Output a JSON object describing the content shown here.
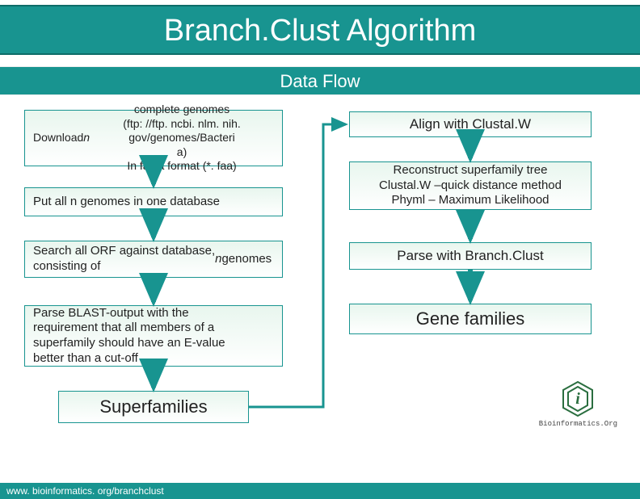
{
  "title": "Branch.Clust Algorithm",
  "subtitle": "Data Flow",
  "left": {
    "box1": "Download n complete genomes\n(ftp: //ftp. ncbi. nlm. nih. gov/genomes/Bacteri\na)\nIn fasta format (*. faa)",
    "box2": "Put all n genomes in one database",
    "box3": "Search all ORF against database,\nconsisting of n genomes",
    "box4": "Parse BLAST-output with the\nrequirement that all members of a\nsuperfamily should have an E-value\nbetter than a cut-off",
    "box5": "Superfamilies"
  },
  "right": {
    "box1": "Align with Clustal.W",
    "box2": "Reconstruct superfamily tree\nClustal.W –quick distance method\nPhyml – Maximum Likelihood",
    "box3": "Parse with Branch.Clust",
    "box4": "Gene families"
  },
  "logo_text": "Bioinformatics.Org",
  "footer": "www. bioinformatics. org/branchclust",
  "colors": {
    "accent": "#189490"
  }
}
